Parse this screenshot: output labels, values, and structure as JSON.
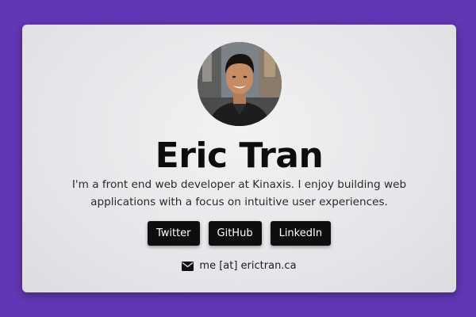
{
  "profile": {
    "name": "Eric Tran",
    "bio": "I'm a front end web developer at Kinaxis. I enjoy building web applications with a focus on intuitive user experiences."
  },
  "links": {
    "twitter_label": "Twitter",
    "github_label": "GitHub",
    "linkedin_label": "LinkedIn"
  },
  "contact": {
    "icon": "mail-icon",
    "email_text": "me [at] erictran.ca"
  },
  "colors": {
    "background": "#6236b4",
    "card": "#e8e8ec",
    "button": "#0e0e0e",
    "button_text": "#ffffff"
  }
}
